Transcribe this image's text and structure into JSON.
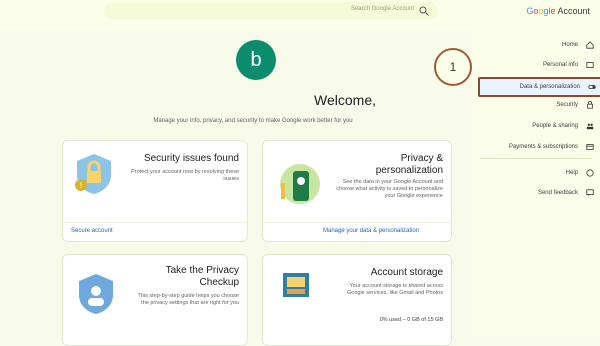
{
  "header": {
    "search_placeholder": "Search Google Account",
    "brand_google": [
      "G",
      "o",
      "o",
      "g",
      "l",
      "e"
    ],
    "brand_account": "Account",
    "icons": [
      "search-icon"
    ]
  },
  "sidebar": {
    "items": [
      {
        "label": "Home",
        "icon": "home-icon"
      },
      {
        "label": "Personal info",
        "icon": "id-card-icon"
      },
      {
        "label": "Data & personalization",
        "icon": "toggle-icon"
      },
      {
        "label": "Security",
        "icon": "lock-icon"
      },
      {
        "label": "People & sharing",
        "icon": "people-icon"
      },
      {
        "label": "Payments & subscriptions",
        "icon": "credit-card-icon"
      },
      {
        "label": "Help",
        "icon": "help-icon"
      },
      {
        "label": "Send feedback",
        "icon": "feedback-icon"
      }
    ],
    "annotation_number": "1"
  },
  "main": {
    "avatar_letter": "b",
    "welcome": "Welcome,",
    "subtitle": "Manage your info, privacy, and security to make Google work better for you",
    "cards": [
      {
        "title": "Security issues found",
        "desc": "Protect your account now by resolving these issues",
        "action": "Secure account"
      },
      {
        "title": "Privacy & personalization",
        "desc": "See the data in your Google Account and choose what activity is saved to personalize your Google experience",
        "action": "Manage your data & personalization"
      },
      {
        "title": "Take the Privacy Checkup",
        "desc": "This step-by-step guide helps you choose the privacy settings that are right for you",
        "action": ""
      },
      {
        "title": "Account storage",
        "desc": "Your account storage is shared across Google services, like Gmail and Photos",
        "usage": "0% used – 0 GB of 15 GB"
      }
    ]
  },
  "colors": {
    "accent": "#0b8d6d",
    "highlight_border": "#8b4a2e",
    "link": "#2a5fc1"
  }
}
